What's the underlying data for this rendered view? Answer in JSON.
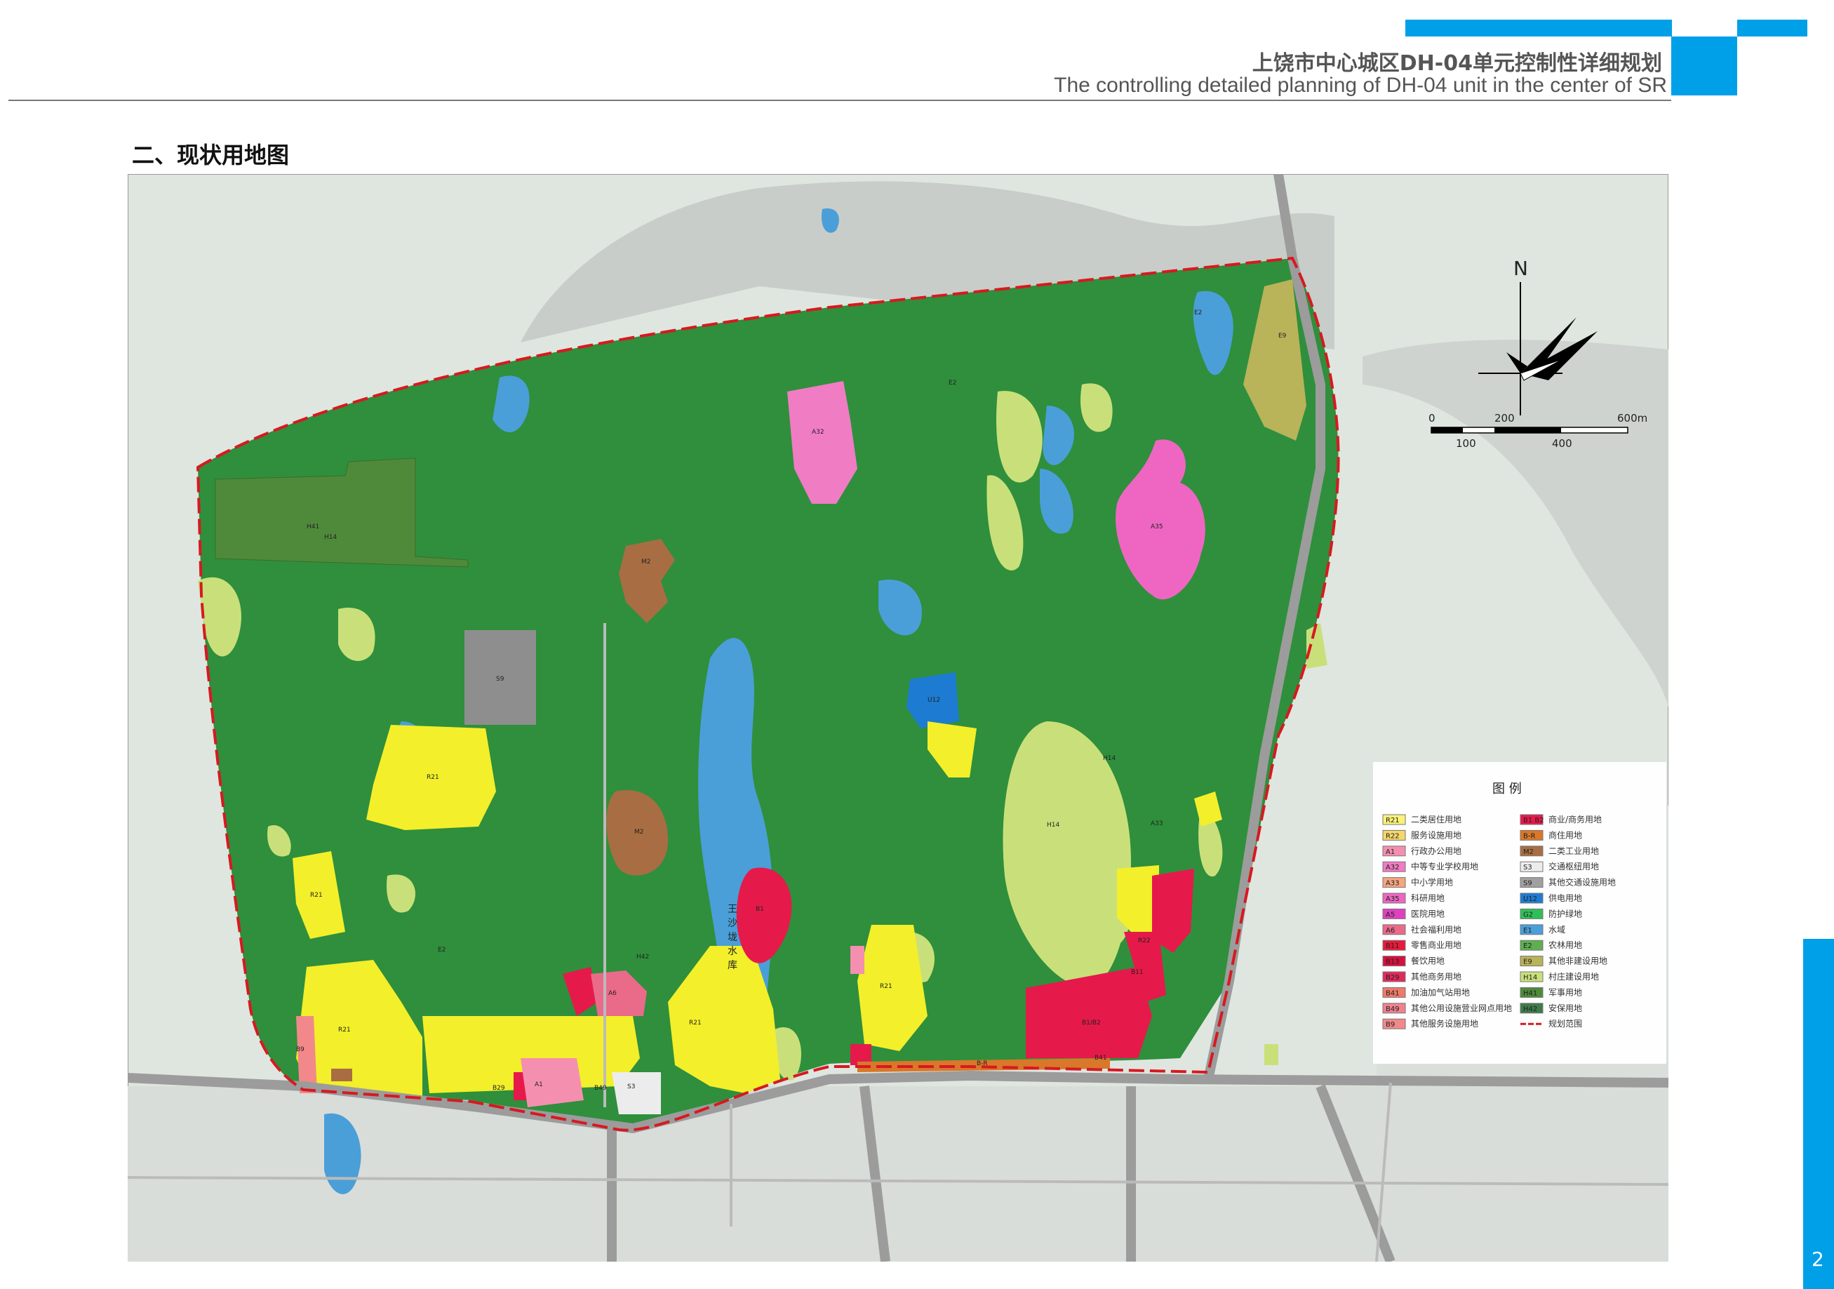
{
  "header": {
    "title_cn": "上饶市中心城区DH-04单元控制性详细规划",
    "title_en": "The controlling detailed planning of DH-04 unit in the center of SR"
  },
  "section_title": "二、现状用地图",
  "page_number": "2",
  "colors": {
    "accent": "#00a0e9",
    "forest": "#2f8f3c",
    "water": "#4a9fd8",
    "residential": "#f3ef2a",
    "village": "#c9e07a",
    "commercial": "#e6194b",
    "industrial": "#a96d43",
    "school": "#f07cc4",
    "military": "#4f8a3b",
    "transport": "#8e8e8e",
    "utility": "#1d7bd1",
    "boundary": "#d71920"
  },
  "north": {
    "label": "N"
  },
  "scale_bar": {
    "top_labels": [
      "0",
      "200",
      "600m"
    ],
    "bottom_labels": [
      "100",
      "400"
    ]
  },
  "map_labels": {
    "reservoir": [
      "王",
      "沙",
      "垅",
      "水",
      "库"
    ],
    "h41": "H41",
    "s9": "S9",
    "u12": "U12",
    "a35": "A35",
    "a32": "A32",
    "e9": "E9",
    "m2": "M2",
    "r21": "R21",
    "h14": "H14",
    "e2": "E2",
    "b1": "B1",
    "b9": "B9",
    "b29": "B29",
    "b49": "B49",
    "br": "B-R",
    "a1": "A1",
    "a6": "A6",
    "s3": "S3",
    "r22": "R22",
    "b11": "B11",
    "b1b2": "B1/B2",
    "a33": "A33",
    "h42": "H42",
    "b41": "B41"
  },
  "legend": {
    "title": "图  例",
    "left": [
      {
        "code": "R21",
        "label": "二类居住用地",
        "color": "#fcf27a"
      },
      {
        "code": "R22",
        "label": "服务设施用地",
        "color": "#f5d66b"
      },
      {
        "code": "A1",
        "label": "行政办公用地",
        "color": "#f58fb0"
      },
      {
        "code": "A32",
        "label": "中等专业学校用地",
        "color": "#f07cc4"
      },
      {
        "code": "A33",
        "label": "中小学用地",
        "color": "#f6a57f"
      },
      {
        "code": "A35",
        "label": "科研用地",
        "color": "#ee66c2"
      },
      {
        "code": "A5",
        "label": "医院用地",
        "color": "#e040c0"
      },
      {
        "code": "A6",
        "label": "社会福利用地",
        "color": "#ea6a8a"
      },
      {
        "code": "B11",
        "label": "零售商业用地",
        "color": "#e8193a"
      },
      {
        "code": "B13",
        "label": "餐饮用地",
        "color": "#d6103c"
      },
      {
        "code": "B29",
        "label": "其他商务用地",
        "color": "#e2295a"
      },
      {
        "code": "B41",
        "label": "加油加气站用地",
        "color": "#ef7a6a"
      },
      {
        "code": "B49",
        "label": "其他公用设施营业网点用地",
        "color": "#f0828e"
      },
      {
        "code": "B9",
        "label": "其他服务设施用地",
        "color": "#f2888a"
      }
    ],
    "right": [
      {
        "code": "B1 B2",
        "label": "商业/商务用地",
        "color": "#e6194b"
      },
      {
        "code": "B-R",
        "label": "商住用地",
        "color": "#d9772a"
      },
      {
        "code": "M2",
        "label": "二类工业用地",
        "color": "#a96d43"
      },
      {
        "code": "S3",
        "label": "交通枢纽用地",
        "color": "#ececec"
      },
      {
        "code": "S9",
        "label": "其他交通设施用地",
        "color": "#a0a0a0"
      },
      {
        "code": "U12",
        "label": "供电用地",
        "color": "#1d7bd1"
      },
      {
        "code": "G2",
        "label": "防护绿地",
        "color": "#2fbf58"
      },
      {
        "code": "E1",
        "label": "水域",
        "color": "#4a9fd8"
      },
      {
        "code": "E2",
        "label": "农林用地",
        "color": "#5fae4f"
      },
      {
        "code": "E9",
        "label": "其他非建设用地",
        "color": "#b9b35a"
      },
      {
        "code": "H14",
        "label": "村庄建设用地",
        "color": "#c9e07a"
      },
      {
        "code": "H41",
        "label": "军事用地",
        "color": "#4f8a3b"
      },
      {
        "code": "H42",
        "label": "安保用地",
        "color": "#3e7a4a"
      },
      {
        "code": "",
        "label": "规划范围",
        "color": "#d71920"
      }
    ]
  }
}
